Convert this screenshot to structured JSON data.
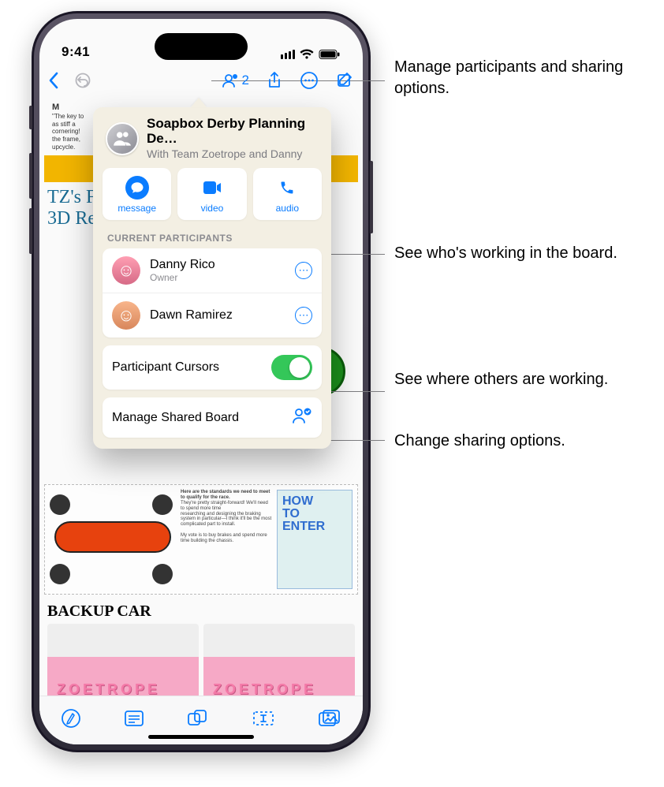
{
  "statusbar": {
    "time": "9:41"
  },
  "topbar": {
    "collab_count": "2"
  },
  "popover": {
    "title": "Soapbox Derby Planning De…",
    "subtitle": "With Team Zoetrope and Danny",
    "contacts": {
      "message": "message",
      "video": "video",
      "audio": "audio"
    },
    "section_label": "CURRENT PARTICIPANTS",
    "participants": [
      {
        "name": "Danny Rico",
        "role": "Owner"
      },
      {
        "name": "Dawn Ramirez",
        "role": ""
      }
    ],
    "cursors_label": "Participant Cursors",
    "cursors_on": true,
    "manage_label": "Manage Shared Board"
  },
  "board": {
    "handnote_line1": "TZ's Fu",
    "handnote_line2": "3D Re",
    "sketch_heading": "Here are the standards we need to meet to qualify for the race.",
    "howto_1": "HOW",
    "howto_2": "TO",
    "howto_3": "ENTER",
    "backup_title": "BACKUP CAR"
  },
  "callouts": {
    "c1": "Manage participants and sharing options.",
    "c2": "See who's working in the board.",
    "c3": "See where others are working.",
    "c4": "Change sharing options."
  }
}
